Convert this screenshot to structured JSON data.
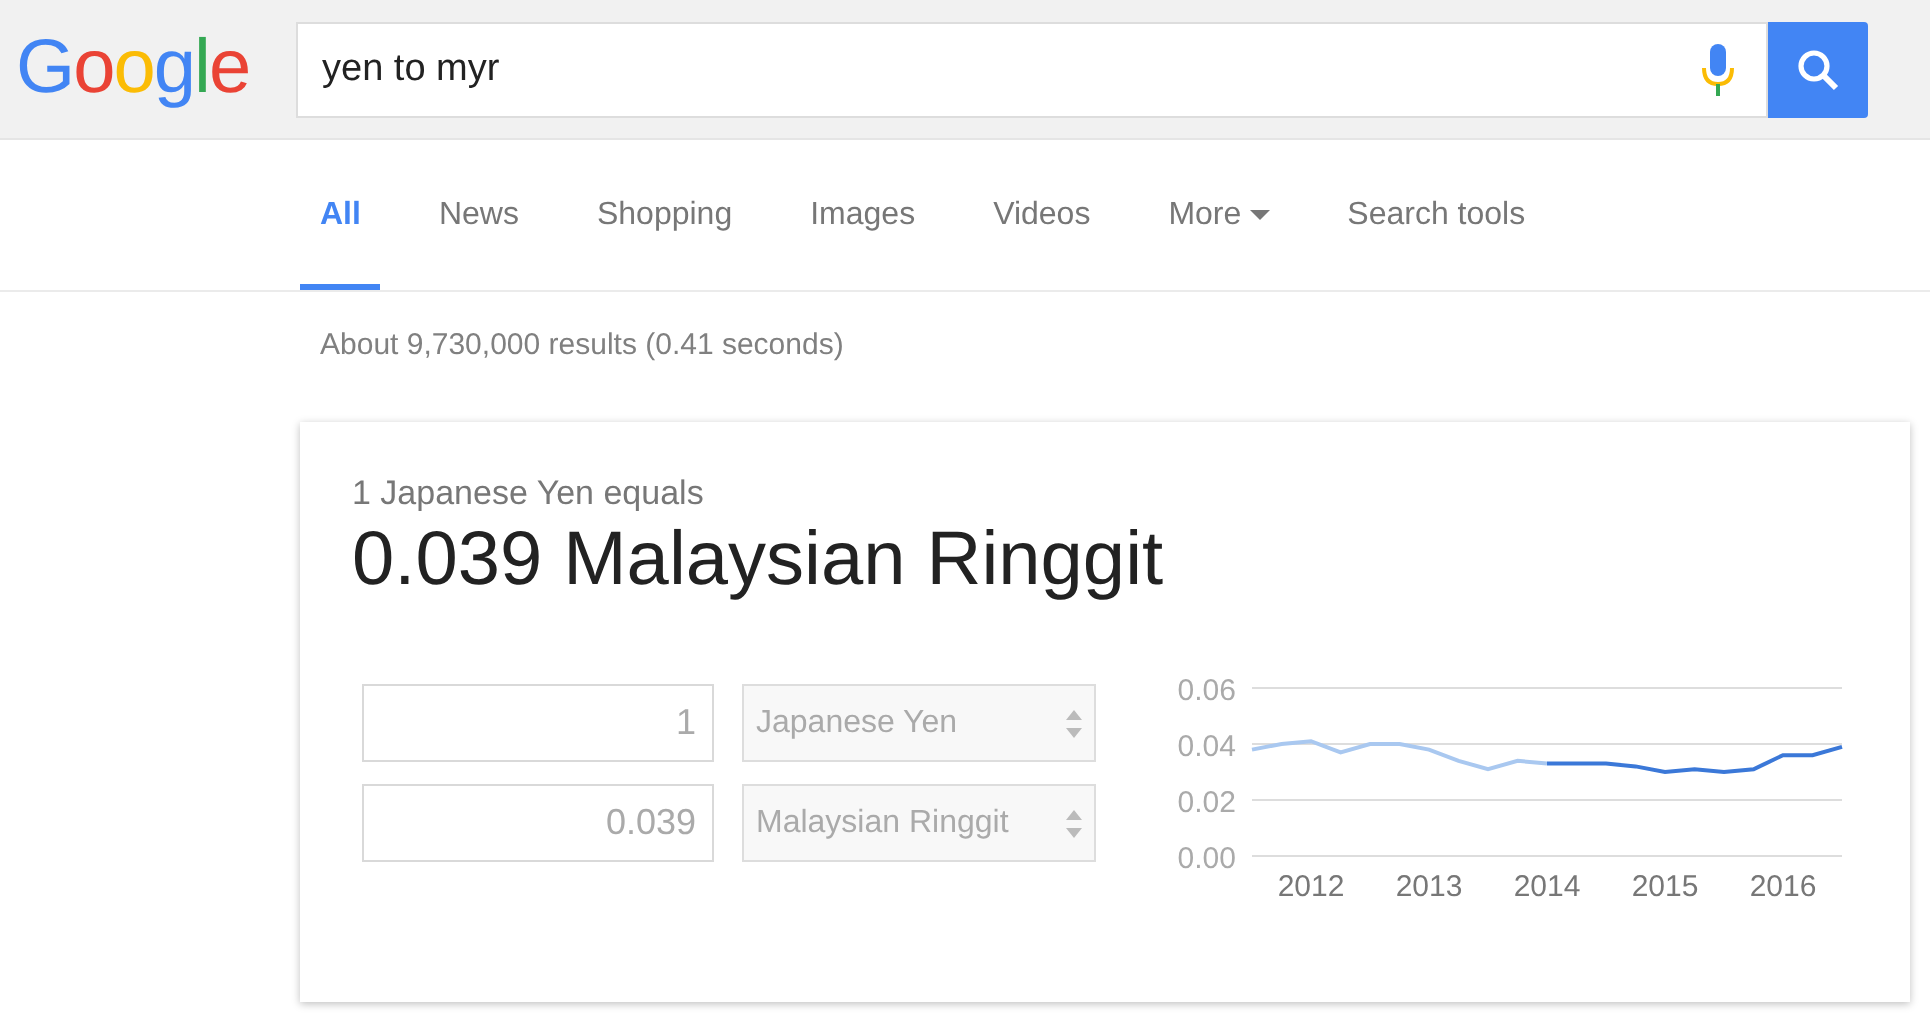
{
  "header": {
    "logo": "Google",
    "query": "yen to myr"
  },
  "tabs": [
    {
      "label": "All",
      "selected": true,
      "kind": "tab"
    },
    {
      "label": "News",
      "selected": false,
      "kind": "tab"
    },
    {
      "label": "Shopping",
      "selected": false,
      "kind": "tab"
    },
    {
      "label": "Images",
      "selected": false,
      "kind": "tab"
    },
    {
      "label": "Videos",
      "selected": false,
      "kind": "tab"
    },
    {
      "label": "More",
      "selected": false,
      "kind": "menu"
    },
    {
      "label": "Search tools",
      "selected": false,
      "kind": "tab"
    }
  ],
  "result_stats": "About 9,730,000 results (0.41 seconds)",
  "converter": {
    "caption": "1 Japanese Yen equals",
    "result": "0.039 Malaysian Ringgit",
    "rows": [
      {
        "amount": "1",
        "currency": "Japanese Yen"
      },
      {
        "amount": "0.039",
        "currency": "Malaysian Ringgit"
      }
    ],
    "chart_data": {
      "type": "line",
      "x": [
        2011.5,
        2011.75,
        2012,
        2012.25,
        2012.5,
        2012.75,
        2013,
        2013.25,
        2013.5,
        2013.75,
        2014,
        2014.25,
        2014.5,
        2014.75,
        2015,
        2015.25,
        2015.5,
        2015.75,
        2016,
        2016.25,
        2016.5
      ],
      "series": [
        {
          "color": "#a9c8f0",
          "values": [
            0.038,
            0.04,
            0.041,
            0.037,
            0.04,
            0.04,
            0.038,
            0.034,
            0.031,
            0.034,
            0.033,
            null,
            null,
            null,
            null,
            null,
            null,
            null,
            null,
            null,
            null
          ]
        },
        {
          "color": "#3b78d8",
          "values": [
            null,
            null,
            null,
            null,
            null,
            null,
            null,
            null,
            null,
            null,
            0.033,
            0.033,
            0.033,
            0.032,
            0.03,
            0.031,
            0.03,
            0.031,
            0.036,
            0.036,
            0.039
          ]
        }
      ],
      "xlim": [
        2011.5,
        2016.5
      ],
      "ylim": [
        0,
        0.06
      ],
      "xticks": [
        {
          "value": 2012,
          "label": "2012"
        },
        {
          "value": 2013,
          "label": "2013"
        },
        {
          "value": 2014,
          "label": "2014"
        },
        {
          "value": 2015,
          "label": "2015"
        },
        {
          "value": 2016,
          "label": "2016"
        }
      ],
      "yticks": [
        {
          "value": 0,
          "label": "0.00"
        },
        {
          "value": 0.02,
          "label": "0.02"
        },
        {
          "value": 0.04,
          "label": "0.04"
        },
        {
          "value": 0.06,
          "label": "0.06"
        }
      ]
    }
  }
}
